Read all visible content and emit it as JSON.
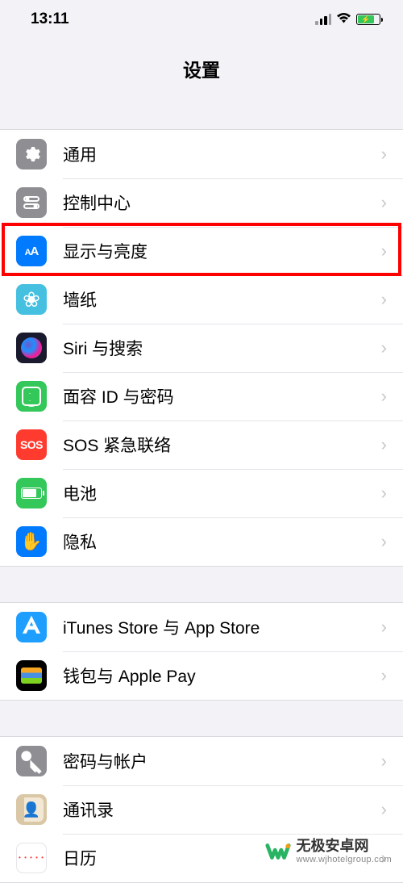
{
  "status": {
    "time": "13:11"
  },
  "header": {
    "title": "设置"
  },
  "groups": [
    {
      "items": [
        {
          "id": "general",
          "label": "通用",
          "icon": "gear",
          "bg": "ic-general"
        },
        {
          "id": "control-center",
          "label": "控制中心",
          "icon": "switches",
          "bg": "ic-control"
        },
        {
          "id": "display",
          "label": "显示与亮度",
          "icon": "aa",
          "bg": "ic-display"
        },
        {
          "id": "wallpaper",
          "label": "墙纸",
          "icon": "flower",
          "bg": "ic-wallpaper"
        },
        {
          "id": "siri",
          "label": "Siri 与搜索",
          "icon": "siri",
          "bg": "ic-siri"
        },
        {
          "id": "faceid",
          "label": "面容 ID 与密码",
          "icon": "faceid",
          "bg": "ic-faceid"
        },
        {
          "id": "sos",
          "label": "SOS 紧急联络",
          "icon": "sos",
          "bg": "ic-sos"
        },
        {
          "id": "battery",
          "label": "电池",
          "icon": "battery",
          "bg": "ic-battery"
        },
        {
          "id": "privacy",
          "label": "隐私",
          "icon": "hand",
          "bg": "ic-privacy"
        }
      ]
    },
    {
      "items": [
        {
          "id": "itunes",
          "label": "iTunes Store 与 App Store",
          "icon": "appstore",
          "bg": "ic-itunes"
        },
        {
          "id": "wallet",
          "label": "钱包与 Apple Pay",
          "icon": "wallet",
          "bg": "ic-wallet"
        }
      ]
    },
    {
      "items": [
        {
          "id": "passwords",
          "label": "密码与帐户",
          "icon": "key",
          "bg": "ic-passwords"
        },
        {
          "id": "contacts",
          "label": "通讯录",
          "icon": "contacts",
          "bg": "ic-contacts"
        },
        {
          "id": "calendar",
          "label": "日历",
          "icon": "calendar",
          "bg": "ic-calendar"
        }
      ]
    }
  ],
  "watermark": {
    "brand": "无极安卓网",
    "url": "www.wjhotelgroup.com"
  }
}
